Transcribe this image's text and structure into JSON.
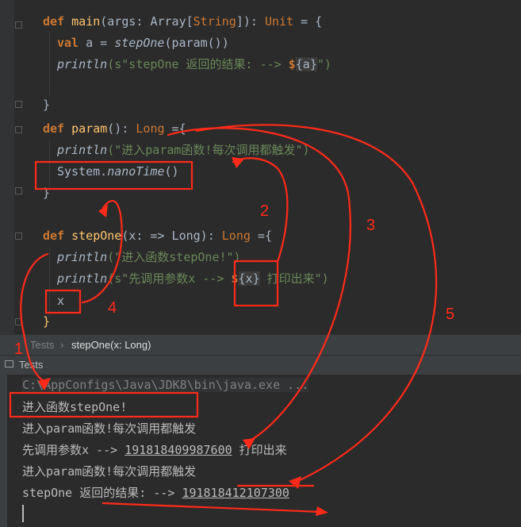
{
  "editor": {
    "lines": {
      "l1": {
        "kw": "def",
        "name": "main",
        "open": "(args: Array[",
        "typ": "String",
        "close": "]): ",
        "ret": "Unit",
        "end": " = {"
      },
      "l2": {
        "kw": "val",
        "rest": " a = ",
        "call": "stepOne",
        "args": "(param())"
      },
      "l3": {
        "fn": "println",
        "pre": "(s\"stepOne 返回的结果: --> ",
        "dollar": "$",
        "brace": "{a}",
        "post": "\")"
      },
      "l5": {
        "close": "}"
      },
      "l6": {
        "kw": "def",
        "name": "param",
        "sig": "(): ",
        "ret": "Long",
        "end": " ={"
      },
      "l7": {
        "fn": "println",
        "str": "(\"进入param函数!每次调用都触发\")"
      },
      "l8": {
        "obj": "System.",
        "method": "nanoTime",
        "args": "()"
      },
      "l9": {
        "close": "}"
      },
      "l11": {
        "kw": "def",
        "name": "stepOne",
        "sig": "(x: => Long): ",
        "ret": "Long",
        "end": " ={"
      },
      "l12": {
        "fn": "println",
        "str": "(\"进入函数stepOne!\")"
      },
      "l13": {
        "fn": "println",
        "pre": "(s\"先调用参数x --> ",
        "dollar": "$",
        "brace": "{x}",
        "post": " 打印出来\")"
      },
      "l14": {
        "text": "x"
      },
      "l15": {
        "close": "}"
      }
    }
  },
  "breadcrumb": {
    "tests": "Tests",
    "separator": "›",
    "current": "stepOne(x: Long)"
  },
  "run_tab": {
    "label": "Tests"
  },
  "console": {
    "lines": [
      "C:\\AppConfigs\\Java\\JDK8\\bin\\java.exe ...",
      "进入函数stepOne!",
      "进入param函数!每次调用都触发",
      "先调用参数x --> 191818409987600 打印出来",
      "进入param函数!每次调用都触发",
      "stepOne 返回的结果: --> 191818412107300"
    ],
    "line4_pre": "先调用参数x --> ",
    "line4_num": "191818409987600",
    "line4_post": " 打印出来",
    "line6_pre": "stepOne 返回的结果: --> ",
    "line6_num": "191818412107300"
  },
  "annotations": {
    "labels": [
      "1",
      "2",
      "3",
      "4",
      "5"
    ],
    "color": "#ff2a1a"
  },
  "colors": {
    "editor_bg": "#2b2b2b",
    "keyword": "#cc7832",
    "function": "#ffc66d",
    "string": "#6a8759",
    "text": "#a9b7c6",
    "panel": "#3c3f41"
  }
}
